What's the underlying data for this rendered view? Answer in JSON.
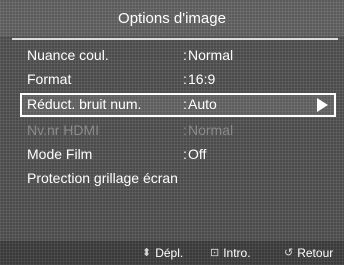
{
  "title": "Options d'image",
  "menu": [
    {
      "label": "Nuance coul.",
      "value": "Normal"
    },
    {
      "label": "Format",
      "value": "16:9"
    },
    {
      "label": "Réduct. bruit num.",
      "value": "Auto"
    },
    {
      "label": "Nv.nr HDMI",
      "value": "Normal"
    },
    {
      "label": "Mode Film",
      "value": "Off"
    },
    {
      "label": "Protection grillage écran",
      "value": ""
    }
  ],
  "footer": {
    "move_label": "Dépl.",
    "enter_label": "Intro.",
    "return_label": "Retour",
    "move_icon": "up-down-arrow-icon",
    "enter_icon": "enter-icon",
    "return_icon": "return-icon"
  }
}
